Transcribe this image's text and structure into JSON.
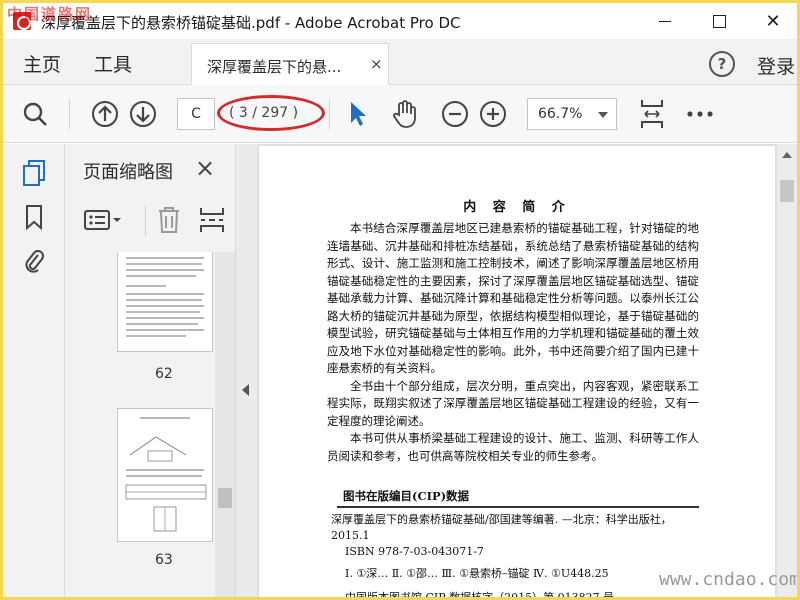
{
  "window": {
    "title": "深厚覆盖层下的悬索桥锚碇基础.pdf - Adobe Acrobat Pro DC",
    "watermark_top": "中国道路网"
  },
  "tabs": {
    "home": "主页",
    "tools": "工具",
    "document_tab": "深厚覆盖层下的悬...",
    "document_close": "×",
    "help": "?",
    "login": "登录"
  },
  "toolbar": {
    "page_input": "C",
    "page_count": "( 3 / 297 )",
    "zoom": "66.7%"
  },
  "thumbnails": {
    "title": "页面缩略图",
    "close": "×",
    "pages": [
      {
        "number": "62"
      },
      {
        "number": "63"
      }
    ]
  },
  "document": {
    "heading": "内 容 简 介",
    "paragraphs": [
      "本书结合深厚覆盖层地区已建悬索桥的锚碇基础工程，针对锚碇的地连墙基础、沉井基础和排桩冻结基础，系统总结了悬索桥锚碇基础的结构形式、设计、施工监测和施工控制技术，阐述了影响深厚覆盖层地区桥用锚碇基础稳定性的主要因素，探讨了深厚覆盖层地区锚碇基础选型、锚碇基础承载力计算、基础沉降计算和基础稳定性分析等问题。以泰州长江公路大桥的锚碇沉井基础为原型，依据结构模型相似理论，基于锚碇基础的模型试验，研究锚碇基础与土体相互作用的力学机理和锚碇基础的覆土效应及地下水位对基础稳定性的影响。此外，书中还简要介绍了国内已建十座悬索桥的有关资料。",
      "全书由十个部分组成，层次分明，重点突出，内容客观，紧密联系工程实际，既翔实叙述了深厚覆盖层地区锚碇基础工程建设的经验，又有一定程度的理论阐述。",
      "本书可供从事桥梁基础工程建设的设计、施工、监测、科研等工作人员阅读和参考，也可供高等院校相关专业的师生参考。"
    ],
    "cip_heading": "图书在版编目(CIP)数据",
    "cip_lines": [
      "深厚覆盖层下的悬索桥锚碇基础/邵国建等编著. —北京：科学出版社，",
      "2015.1",
      "ISBN 978-7-03-043071-7",
      "Ⅰ. ①深…  Ⅱ. ①邵…  Ⅲ. ①悬索桥–锚碇   Ⅳ. ①U448.25",
      "中国版本图书馆 CIP 数据核字（2015）第 013827 号"
    ]
  },
  "watermark_bottom": "www.cndao.com",
  "colors": {
    "frame": "#f2d94f",
    "accent_blue": "#1f6ec7",
    "annotation_red": "#d42a2a"
  }
}
